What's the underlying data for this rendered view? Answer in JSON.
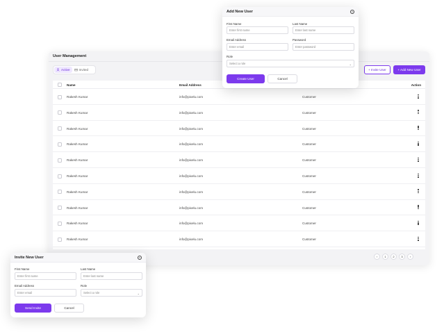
{
  "main": {
    "title": "User Management",
    "tabs": [
      {
        "label": "Active",
        "active": true,
        "icon": "user-icon"
      },
      {
        "label": "Invited",
        "active": false,
        "icon": "mail-icon"
      }
    ],
    "invite_button": "Invite User",
    "add_button": "Add New User",
    "columns": {
      "name": "Name",
      "email": "Email Address",
      "action": "Action"
    },
    "rows": [
      {
        "name": "Rakesh Kumar",
        "email": "info@pixelu.com",
        "role": "Customer"
      },
      {
        "name": "Rakesh Kumar",
        "email": "info@pixelu.com",
        "role": "Customer"
      },
      {
        "name": "Rakesh Kumar",
        "email": "info@pixelu.com",
        "role": "Customer"
      },
      {
        "name": "Rakesh Kumar",
        "email": "info@pixelu.com",
        "role": "Customer"
      },
      {
        "name": "Rakesh Kumar",
        "email": "info@pixelu.com",
        "role": "Customer"
      },
      {
        "name": "Rakesh Kumar",
        "email": "info@pixelu.com",
        "role": "Customer"
      },
      {
        "name": "Rakesh Kumar",
        "email": "info@pixelu.com",
        "role": "Customer"
      },
      {
        "name": "Rakesh Kumar",
        "email": "info@pixelu.com",
        "role": "Customer"
      },
      {
        "name": "Rakesh Kumar",
        "email": "info@pixelu.com",
        "role": "Customer"
      },
      {
        "name": "Rakesh Kumar",
        "email": "info@pixelu.com",
        "role": "Customer"
      }
    ],
    "pagination": {
      "prev": "‹",
      "pages": [
        "1",
        "2",
        "3"
      ],
      "next": "›"
    }
  },
  "add_modal": {
    "title": "Add New User",
    "first_name_label": "First Name",
    "first_name_placeholder": "Enter first name",
    "last_name_label": "Last Name",
    "last_name_placeholder": "Enter last name",
    "email_label": "Email Address",
    "email_placeholder": "Enter email",
    "password_label": "Password",
    "password_placeholder": "Enter password",
    "role_label": "Role",
    "role_placeholder": "Select a role",
    "submit": "Create User",
    "cancel": "Cancel"
  },
  "invite_modal": {
    "title": "Invite New User",
    "first_name_label": "First Name",
    "first_name_placeholder": "Enter first name",
    "last_name_label": "Last Name",
    "last_name_placeholder": "Enter last name",
    "email_label": "Email Address",
    "email_placeholder": "Enter email",
    "role_label": "Role",
    "role_placeholder": "Select a role",
    "submit": "Send Invite",
    "cancel": "Cancel"
  },
  "colors": {
    "accent": "#7c3aed",
    "accent_light": "#efe8ff",
    "panel_bg": "#f3f3f5"
  }
}
